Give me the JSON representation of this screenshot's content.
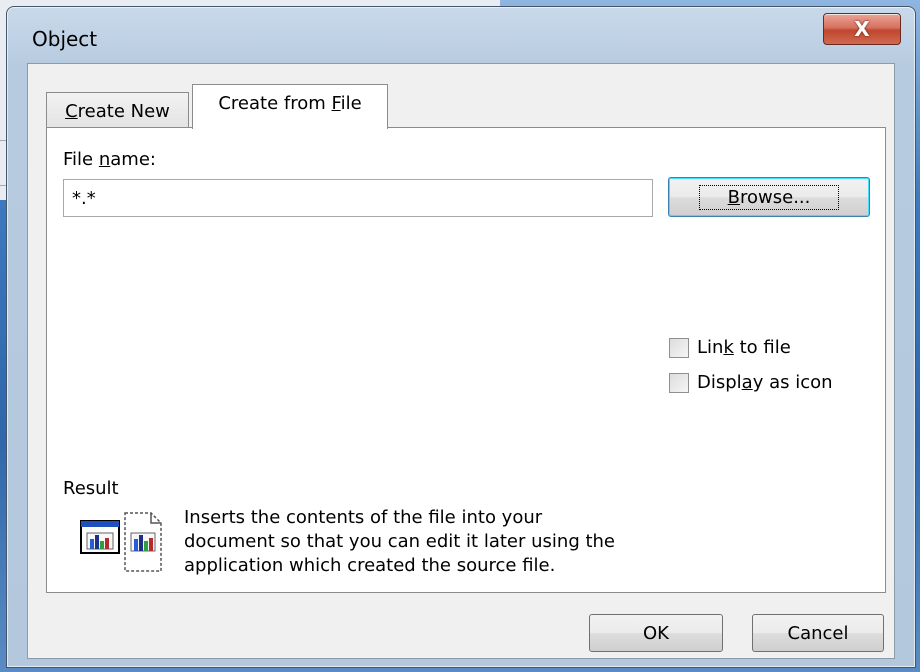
{
  "dialog": {
    "title": "Object",
    "close_label": "X"
  },
  "tabs": [
    {
      "label": "Create New",
      "mnemonic": "C",
      "rest": "reate New",
      "active": false
    },
    {
      "label": "Create from File",
      "prefix": "Create from ",
      "mnemonic": "F",
      "rest": "ile",
      "active": true
    }
  ],
  "file_name": {
    "label_prefix": "File ",
    "label_mnemonic": "n",
    "label_rest": "ame:",
    "value": "*.*"
  },
  "browse_button": {
    "mnemonic": "B",
    "rest": "rowse..."
  },
  "checkboxes": {
    "link": {
      "prefix": "Lin",
      "mnemonic": "k",
      "rest": " to file",
      "checked": false
    },
    "icon": {
      "prefix": "Displ",
      "mnemonic": "a",
      "rest": "y as icon",
      "checked": false
    }
  },
  "result": {
    "label": "Result",
    "lines": [
      "Inserts the contents of the file into your",
      "document so that you can edit it later using the",
      "application which created the source file."
    ],
    "icon": "embedded-object-icon"
  },
  "buttons": {
    "ok_label": "OK",
    "cancel_label": "Cancel"
  },
  "colors": {
    "close_button": "#c9533c",
    "focus_border": "#3c7fb1"
  }
}
